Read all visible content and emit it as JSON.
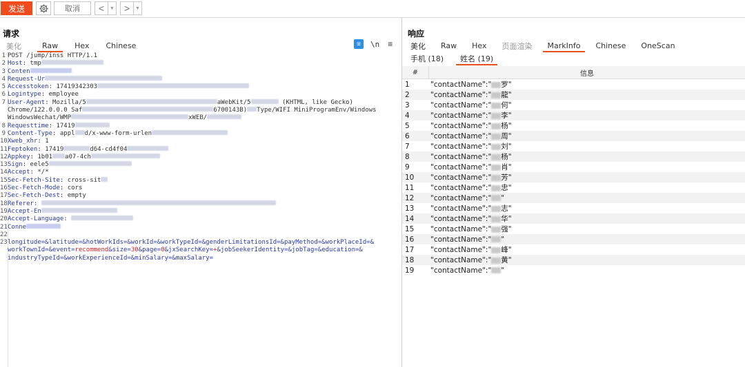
{
  "toolbar": {
    "send_label": "发送",
    "cancel_label": "取消",
    "back_glyph": "<",
    "forward_glyph": ">",
    "dropdown_glyph": "▼"
  },
  "request": {
    "title": "请求",
    "tabs": [
      "美化",
      "Raw",
      "Hex",
      "Chinese"
    ],
    "active_tab": "Raw",
    "wrap_icon": "≡",
    "newline_label": "\\n",
    "menu_icon": "≡",
    "lines": [
      {
        "n": "1",
        "key": "POST /jump/inss HTTP/1.1",
        "val": ""
      },
      {
        "n": "2",
        "key": "Host",
        "val": "tmp"
      },
      {
        "n": "3",
        "key": "Conten",
        "val": ""
      },
      {
        "n": "4",
        "key": "Request-Ur",
        "val": ""
      },
      {
        "n": "5",
        "key": "Accesstoken",
        "val": "17419342303"
      },
      {
        "n": "6",
        "key": "Logintype",
        "val": "employee"
      },
      {
        "n": "7",
        "key": "User-Agent",
        "val": "Mozilla/5"
      },
      {
        "n": "",
        "key": "",
        "val": "Chrome/122.0.0.0 Saf"
      },
      {
        "n": "",
        "key": "",
        "val": "WindowsWechat/WMP"
      },
      {
        "n": "8",
        "key": "Requesttime",
        "val": "17419"
      },
      {
        "n": "9",
        "key": "Content-Type",
        "val": "appl"
      },
      {
        "n": "10",
        "key": "Xweb_xhr",
        "val": "1"
      },
      {
        "n": "11",
        "key": "Feptoken",
        "val": "17419"
      },
      {
        "n": "12",
        "key": "Appkey",
        "val": "1b01"
      },
      {
        "n": "13",
        "key": "Sign",
        "val": "eele5"
      },
      {
        "n": "14",
        "key": "Accept",
        "val": "*/*"
      },
      {
        "n": "15",
        "key": "Sec-Fetch-Site",
        "val": "cross-sit"
      },
      {
        "n": "16",
        "key": "Sec-Fetch-Mode",
        "val": "cors"
      },
      {
        "n": "17",
        "key": "Sec-Fetch-Dest",
        "val": "empty"
      },
      {
        "n": "18",
        "key": "Referer",
        "val": ""
      },
      {
        "n": "19",
        "key": "Accept-En",
        "val": ""
      },
      {
        "n": "20",
        "key": "Accept-Language",
        "val": ""
      },
      {
        "n": "21",
        "key": "Conne",
        "val": ""
      },
      {
        "n": "22",
        "key": "",
        "val": ""
      }
    ],
    "ua_tail_1": "aWebKit/5",
    "ua_tail_2": "(KHTML, like Gecko)",
    "chrome_tail_1": "6700143B)",
    "chrome_tail_2": "Type/WIFI MiniProgramEnv/Windows",
    "wmp_tail": "xWEB/",
    "ctype_tail": "d/x-www-form-urlen",
    "fep_tail": "d64-cd4f04",
    "appkey_tail": "a07-4ch",
    "body_line_num": "23",
    "body_line_1": "longitude=&latitude=&hotWorkIds=&workId=&workTypeId=&genderLimitationsId=&payMethod=&workPlaceId=&",
    "body_line_2_a": "workTownId=&event=",
    "body_line_2_red": "recommend",
    "body_line_2_b": "&size=",
    "body_line_2_red2": "30",
    "body_line_2_c": "&page=",
    "body_line_2_red3": "0",
    "body_line_2_d": "&jxSearchKey=",
    "body_line_2_red4": "+",
    "body_line_2_e": "&jobSeekerIdentity=&jobTag=&education=&",
    "body_line_3": "industryTypeId=&workExperienceId=&minSalary=&maxSalary="
  },
  "response": {
    "title": "响应",
    "tabs": [
      "美化",
      "Raw",
      "Hex",
      "页面渲染",
      "MarkInfo",
      "Chinese",
      "OneScan"
    ],
    "active_tab": "MarkInfo",
    "subtabs": [
      "手机 (18)",
      "姓名 (19)"
    ],
    "active_subtab": "姓名 (19)",
    "col_num": "#",
    "col_info": "信息",
    "rows": [
      {
        "n": "1",
        "pre": "\"contactName\":\"",
        "mid": "罗",
        "post": "\""
      },
      {
        "n": "2",
        "pre": "\"contactName\":\"",
        "mid": "龍",
        "post": "\""
      },
      {
        "n": "3",
        "pre": "\"contactName\":\"",
        "mid": "何",
        "post": "\""
      },
      {
        "n": "4",
        "pre": "\"contactName\":\"",
        "mid": "李",
        "post": "\""
      },
      {
        "n": "5",
        "pre": "\"contactName\":\"",
        "mid": "杨",
        "post": "\""
      },
      {
        "n": "6",
        "pre": "\"contactName\":\"",
        "mid": "周",
        "post": "\""
      },
      {
        "n": "7",
        "pre": "\"contactName\":\"",
        "mid": "刘",
        "post": "\""
      },
      {
        "n": "8",
        "pre": "\"contactName\":\"",
        "mid": "杨",
        "post": "\""
      },
      {
        "n": "9",
        "pre": "\"contactName\":\"",
        "mid": "肖",
        "post": "\""
      },
      {
        "n": "10",
        "pre": "\"contactName\":\"",
        "mid": "芳",
        "post": "\""
      },
      {
        "n": "11",
        "pre": "\"contactName\":\"",
        "mid": "忠",
        "post": "\""
      },
      {
        "n": "12",
        "pre": "\"contactName\":\"",
        "mid": "",
        "post": "\""
      },
      {
        "n": "13",
        "pre": "\"contactName\":\"",
        "mid": "志",
        "post": "\""
      },
      {
        "n": "14",
        "pre": "\"contactName\":\"",
        "mid": "华",
        "post": "\""
      },
      {
        "n": "15",
        "pre": "\"contactName\":\"",
        "mid": "强",
        "post": "\""
      },
      {
        "n": "16",
        "pre": "\"contactName\":\"",
        "mid": "",
        "post": "\""
      },
      {
        "n": "17",
        "pre": "\"contactName\":\"",
        "mid": "峰",
        "post": "\""
      },
      {
        "n": "18",
        "pre": "\"contactName\":\"",
        "mid": "黄",
        "post": "\""
      },
      {
        "n": "19",
        "pre": "\"contactName\":\"",
        "mid": "",
        "post": "\""
      }
    ]
  },
  "colors": {
    "accent": "#e8501c",
    "send": "#f04a1d",
    "header_key": "#2a3aa8",
    "body_red": "#d62020",
    "wrap_blue": "#2f8de4"
  }
}
